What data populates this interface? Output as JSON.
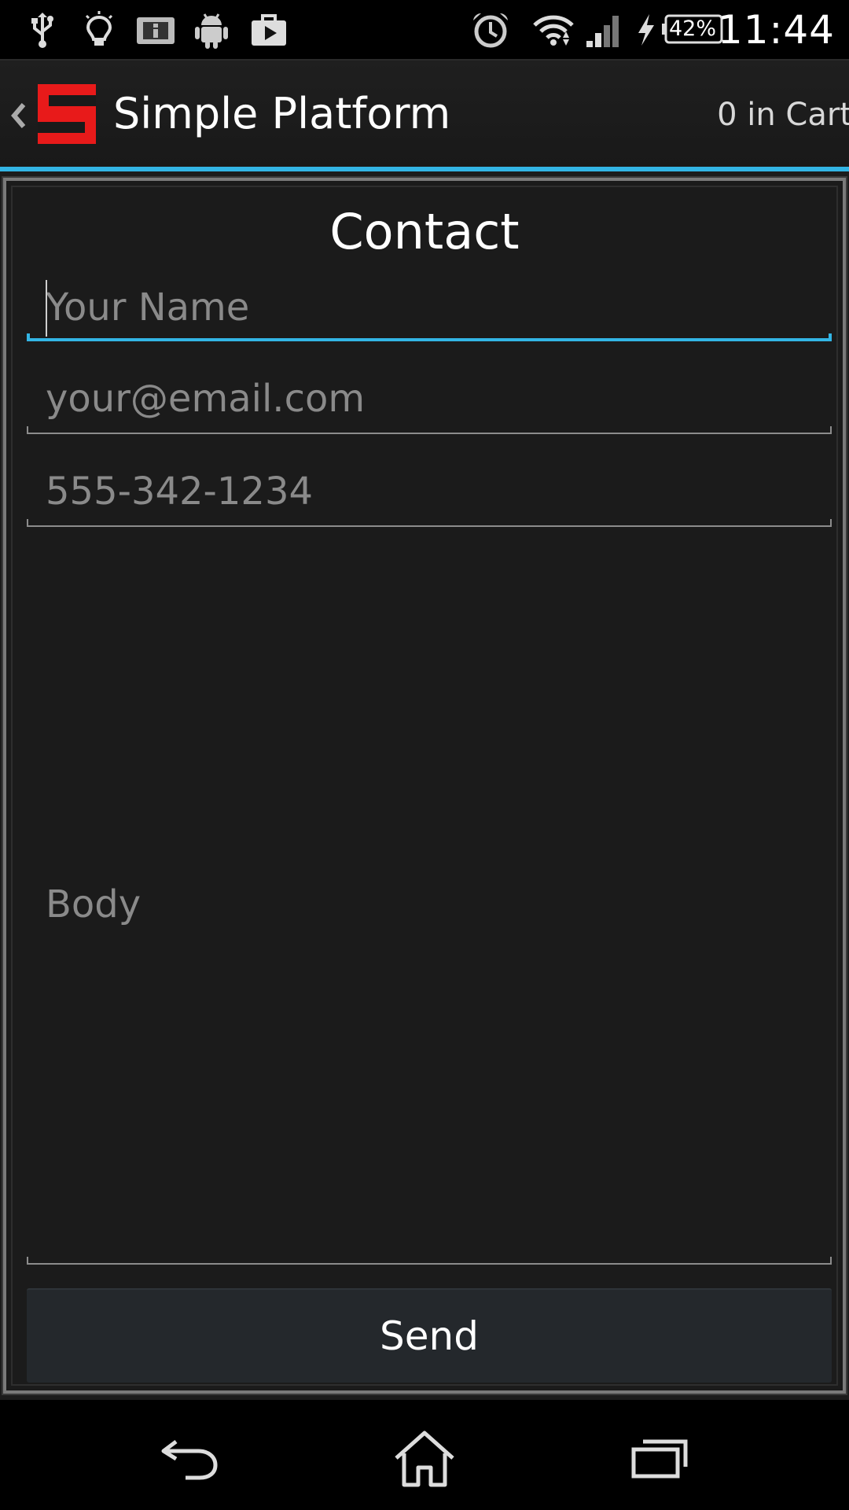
{
  "status_bar": {
    "battery_percent": "42%",
    "time": "11:44",
    "icons": [
      "usb-icon",
      "lightbulb-icon",
      "info-icon",
      "android-icon",
      "briefcase-play-icon",
      "alarm-icon",
      "wifi-icon",
      "signal-icon",
      "charging-bolt-icon",
      "battery-icon"
    ]
  },
  "action_bar": {
    "title": "Simple Platform",
    "cart": "0 in Cart",
    "logo_letter": "S",
    "logo_color": "#e81a1a",
    "accent_color": "#33b5e5"
  },
  "contact_form": {
    "title": "Contact",
    "name_placeholder": "Your Name",
    "name_value": "",
    "email_placeholder": "your@email.com",
    "email_value": "",
    "phone_placeholder": "555-342-1234",
    "phone_value": "",
    "body_placeholder": "Body",
    "body_value": "",
    "send_label": "Send"
  },
  "nav_bar": {
    "buttons": [
      "back-icon",
      "home-icon",
      "recents-icon"
    ]
  }
}
